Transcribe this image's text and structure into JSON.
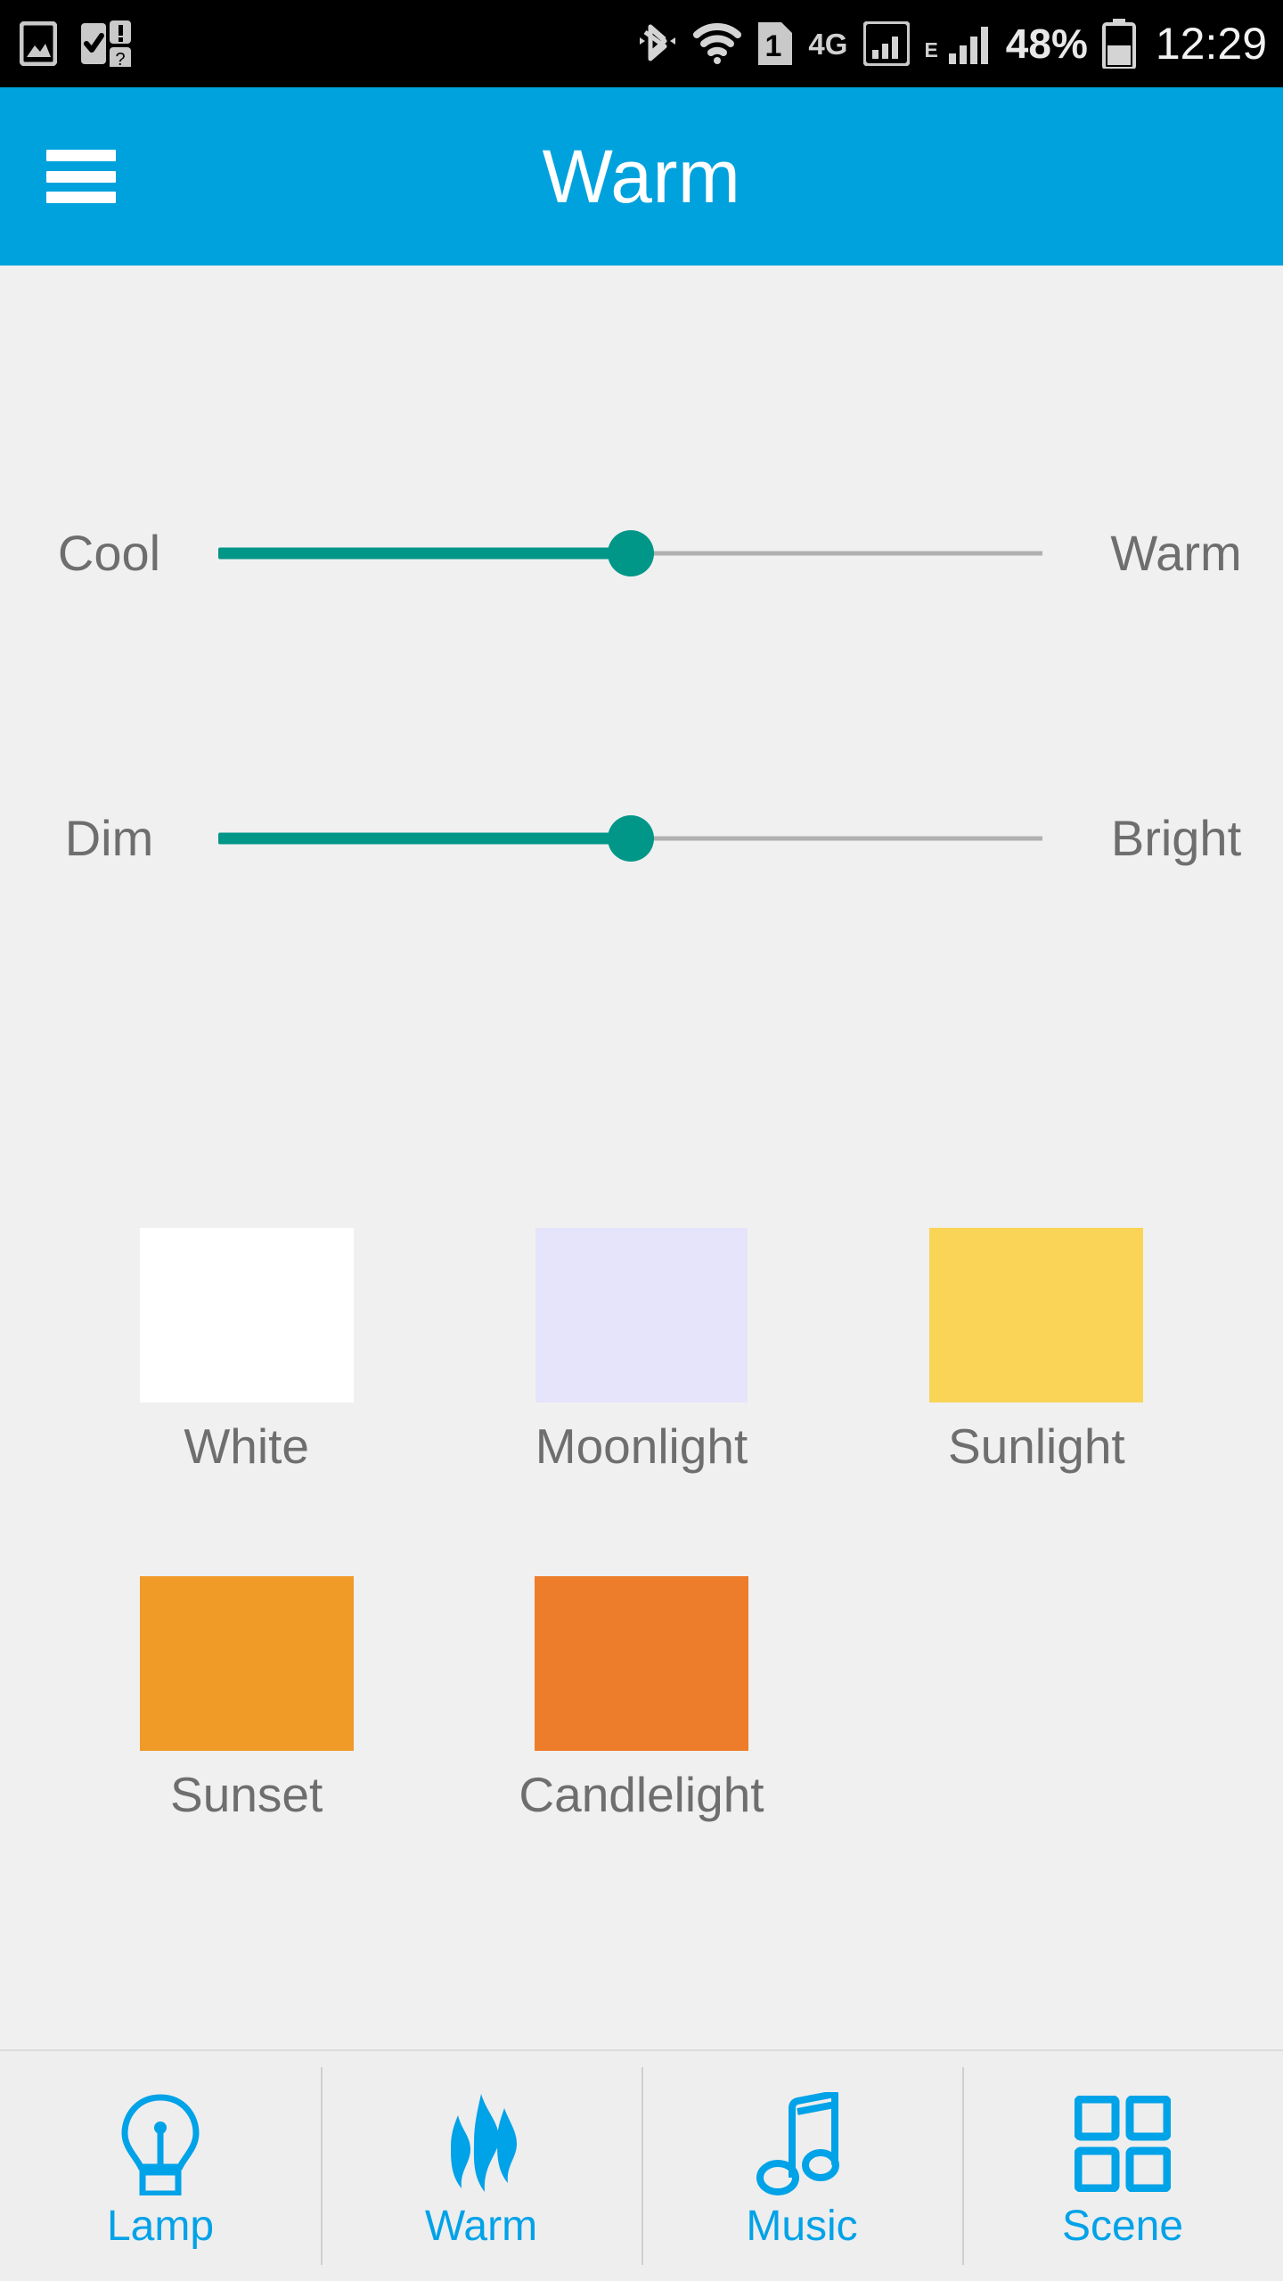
{
  "status_bar": {
    "battery_percent": "48%",
    "time": "12:29",
    "network_type": "4G",
    "edge_indicator": "E",
    "sim_label": "1",
    "icons": [
      "gallery-image-icon",
      "task-checklist-icon",
      "bluetooth-icon",
      "wifi-icon",
      "sim-card-icon",
      "signal-bars-icon",
      "battery-icon"
    ]
  },
  "app_bar": {
    "title": "Warm",
    "menu_icon": "hamburger-menu-icon",
    "background_color": "#00a2dd"
  },
  "sliders": [
    {
      "id": "color-temperature",
      "left_label": "Cool",
      "right_label": "Warm",
      "value": 50,
      "fill_color": "#009688",
      "track_color": "#b0b0b0"
    },
    {
      "id": "brightness",
      "left_label": "Dim",
      "right_label": "Bright",
      "value": 50,
      "fill_color": "#009688",
      "track_color": "#b0b0b0"
    }
  ],
  "presets": {
    "row_a": [
      {
        "label": "White",
        "color": "#ffffff"
      },
      {
        "label": "Moonlight",
        "color": "#e5e4fa"
      },
      {
        "label": "Sunlight",
        "color": "#f9d457"
      }
    ],
    "row_b": [
      {
        "label": "Sunset",
        "color": "#f09a28"
      },
      {
        "label": "Candlelight",
        "color": "#ee7d2b"
      }
    ]
  },
  "bottom_nav": {
    "accent_color": "#00a2e8",
    "items": [
      {
        "label": "Lamp",
        "icon": "light-bulb-icon"
      },
      {
        "label": "Warm",
        "icon": "flame-heat-icon"
      },
      {
        "label": "Music",
        "icon": "music-note-icon"
      },
      {
        "label": "Scene",
        "icon": "grid-squares-icon"
      }
    ]
  }
}
